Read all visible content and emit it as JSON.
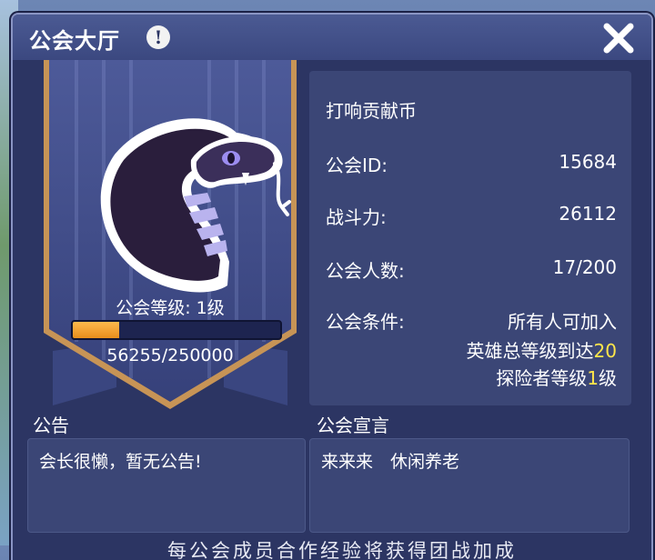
{
  "window": {
    "title": "公会大厅"
  },
  "guild": {
    "name": "打响贡献币",
    "id_label": "公会ID:",
    "id_value": "15684",
    "power_label": "战斗力:",
    "power_value": "26112",
    "members_label": "公会人数:",
    "members_value": "17/200",
    "condition_label": "公会条件:",
    "condition_value": "所有人可加入",
    "req_hero_text": "英雄总等级到达",
    "req_hero_num": "20",
    "req_explorer_text": "探险者等级",
    "req_explorer_num": "1",
    "req_explorer_suffix": "级"
  },
  "level": {
    "label": "公会等级: 1级",
    "exp_text": "56255/250000",
    "progress_fraction": 0.225
  },
  "notice": {
    "title": "公告",
    "content": "会长很懒，暂无公告!"
  },
  "declaration": {
    "title": "公会宣言",
    "content": "来来来　休闲养老"
  },
  "footer_partial": "每公会成员合作经验将获得团战加成"
}
